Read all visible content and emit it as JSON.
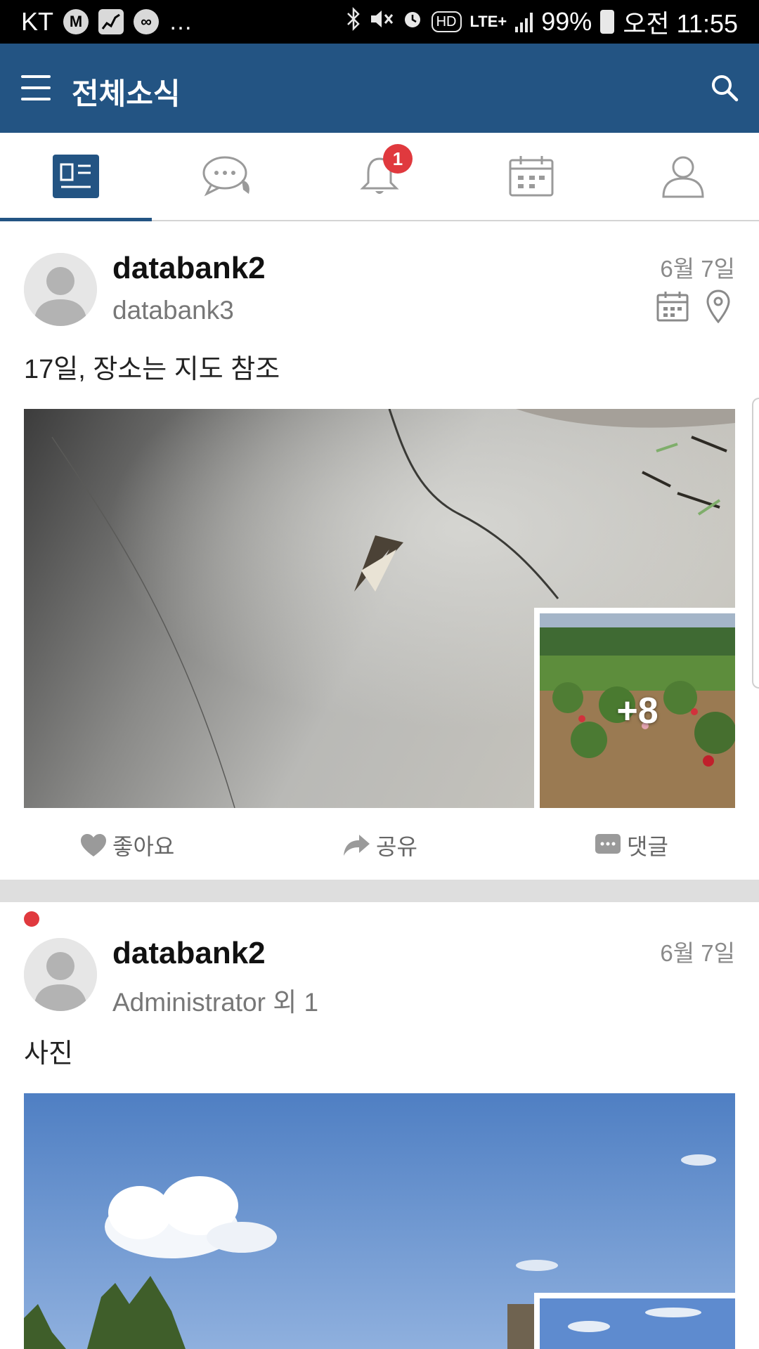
{
  "status_bar": {
    "carrier": "KT",
    "battery": "99%",
    "time": "오전 11:55",
    "notification_icons": [
      "m-icon",
      "stock-chart-icon",
      "app-icon"
    ],
    "system_icons": [
      "bluetooth-icon",
      "mute-icon",
      "alarm-icon",
      "hd-icon",
      "lte-icon",
      "signal-icon",
      "battery-icon"
    ],
    "lte_label": "LTE+",
    "hd_label": "HD"
  },
  "header": {
    "title": "전체소식",
    "color": "#235483"
  },
  "tabs": [
    {
      "name": "feed",
      "icon": "news-feed-icon",
      "active": true
    },
    {
      "name": "chat",
      "icon": "chat-bubbles-icon",
      "active": false
    },
    {
      "name": "notifications",
      "icon": "bell-icon",
      "active": false,
      "badge": "1"
    },
    {
      "name": "calendar",
      "icon": "calendar-icon",
      "active": false
    },
    {
      "name": "profile",
      "icon": "person-icon",
      "active": false
    }
  ],
  "posts": [
    {
      "author": "databank2",
      "target": "databank3",
      "date": "6월 7일",
      "text": "17일, 장소는 지도 참조",
      "more_photos": "+8",
      "meta_icons": [
        "calendar-icon",
        "map-pin-icon"
      ]
    },
    {
      "author": "databank2",
      "target": "Administrator 외 1",
      "date": "6월 7일",
      "text": "사진",
      "unread": true
    }
  ],
  "actions": {
    "like": "좋아요",
    "share": "공유",
    "comment": "댓글"
  },
  "colors": {
    "accent": "#235483",
    "badge": "#e0393e",
    "divider": "#dedede"
  }
}
